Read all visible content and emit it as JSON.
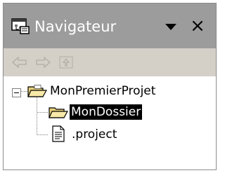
{
  "navigator": {
    "title": "Navigateur",
    "view_icon": "navigator-view-icon",
    "menu_icon": "view-menu-icon",
    "close_label": "×",
    "toolbar": [
      {
        "name": "back-icon",
        "enabled": false
      },
      {
        "name": "forward-icon",
        "enabled": false
      },
      {
        "name": "up-icon",
        "enabled": false
      }
    ],
    "tree": {
      "root": {
        "label": "MonPremierProjet",
        "icon": "open-project-folder-icon",
        "expanded": true,
        "children": [
          {
            "label": "MonDossier",
            "icon": "open-folder-icon",
            "selected": true
          },
          {
            "label": ".project",
            "icon": "text-file-icon",
            "selected": false
          }
        ]
      }
    }
  },
  "colors": {
    "title_bar": "#9c9c9c",
    "toolbar": "#d4d0c8",
    "selection": "#000000",
    "folder": "#f2dc8a",
    "disabled_icon": "#b8b4ac"
  }
}
